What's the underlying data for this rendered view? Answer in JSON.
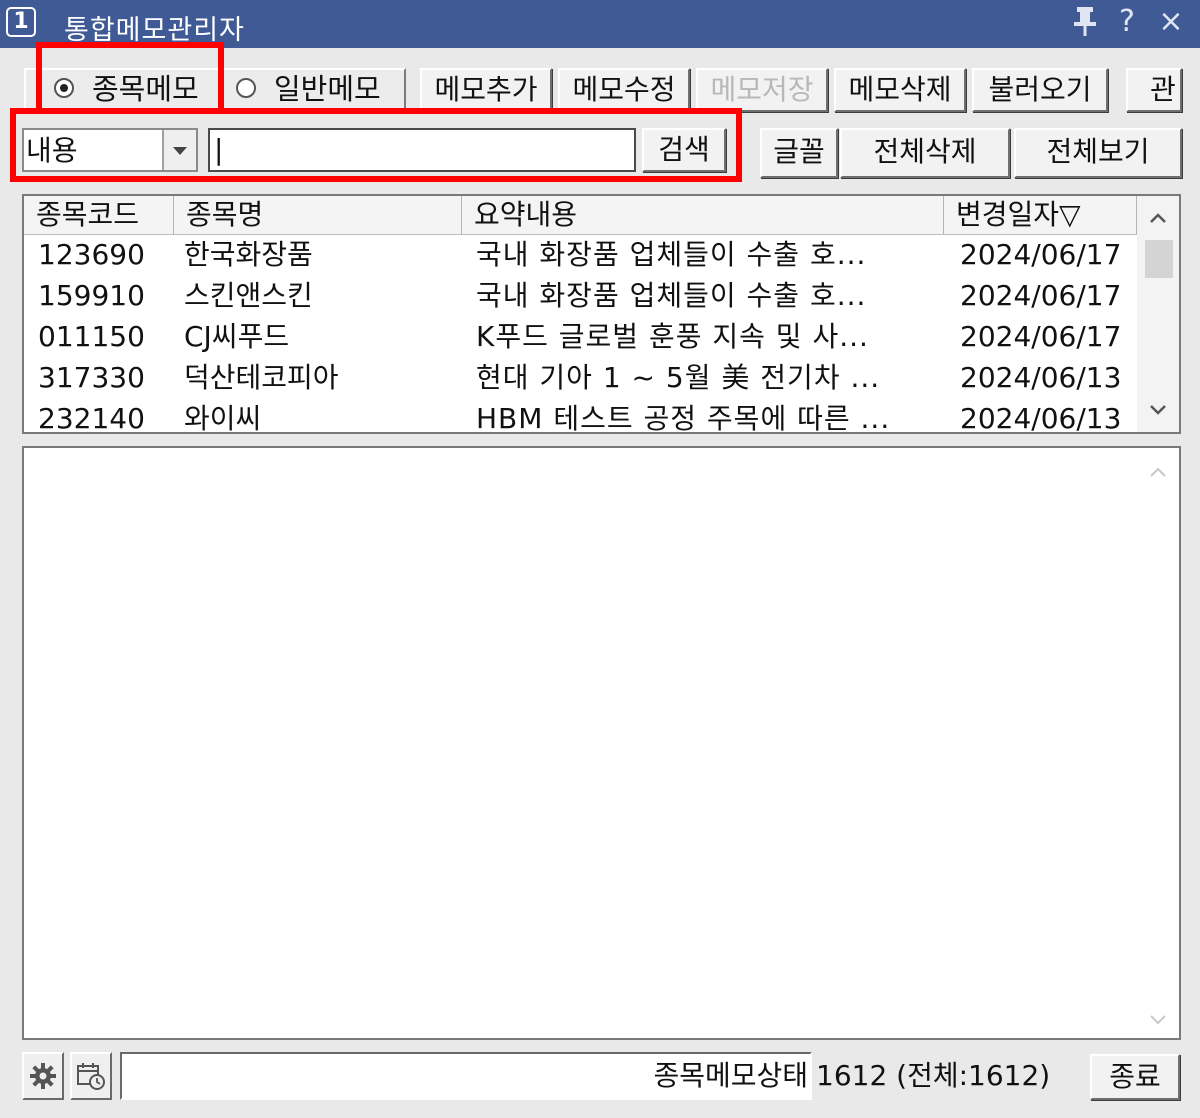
{
  "window": {
    "number_badge": "1",
    "title": "통합메모관리자",
    "pin_icon": "pin-icon",
    "help_label": "?",
    "close_label": "×"
  },
  "memo_type": {
    "options": [
      "종목메모",
      "일반메모"
    ],
    "selected": "종목메모"
  },
  "toolbar1": {
    "add": "메모추가",
    "edit": "메모수정",
    "save": "메모저장",
    "delete": "메모삭제",
    "load": "불러오기",
    "manage": "관"
  },
  "search": {
    "field_selected": "내용",
    "input_value": "|",
    "search_button": "검색"
  },
  "toolbar2": {
    "font": "글꼴",
    "delete_all": "전체삭제",
    "view_all": "전체보기"
  },
  "table": {
    "columns": [
      "종목코드",
      "종목명",
      "요약내용",
      "변경일자▽"
    ],
    "rows": [
      {
        "code": "123690",
        "name": "한국화장품",
        "summary": "국내 화장품 업체들이 수출 호...",
        "date": "2024/06/17"
      },
      {
        "code": "159910",
        "name": "스킨앤스킨",
        "summary": "국내 화장품 업체들이 수출 호...",
        "date": "2024/06/17"
      },
      {
        "code": "011150",
        "name": "CJ씨푸드",
        "summary": "K푸드 글로벌 훈풍 지속 및 사...",
        "date": "2024/06/17"
      },
      {
        "code": "317330",
        "name": "덕산테코피아",
        "summary": "현대 기아 1 ~ 5월 美 전기차 ...",
        "date": "2024/06/13"
      },
      {
        "code": "232140",
        "name": "와이씨",
        "summary": "HBM 테스트 공정 주목에 따른 ...",
        "date": "2024/06/13"
      }
    ]
  },
  "memo_content": "",
  "status": {
    "settings_icon": "gear-icon",
    "calendar_icon": "calendar-clock-icon",
    "label": "종목메모상태",
    "count": "1612 (전체:1612)",
    "close_button": "종료"
  },
  "colors": {
    "titlebar": "#3f5a95",
    "highlight": "#ff0000",
    "window_bg": "#e9e9e9"
  }
}
